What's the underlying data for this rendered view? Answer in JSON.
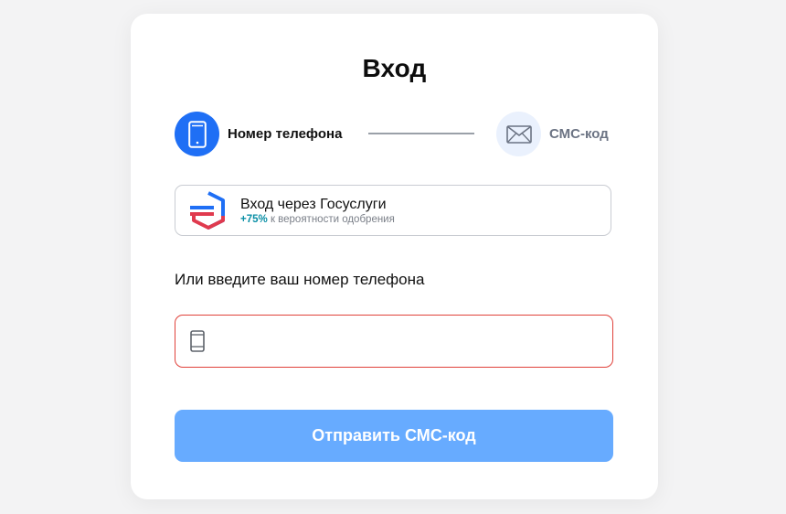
{
  "login": {
    "title": "Вход",
    "steps": [
      {
        "label": "Номер телефона",
        "icon": "phone-icon",
        "state": "active"
      },
      {
        "label": "СМС-код",
        "icon": "envelope-icon",
        "state": "inactive"
      }
    ],
    "gosuslugi": {
      "title": "Вход через Госуслуги",
      "percent": "+75%",
      "subtitle": "к вероятности одобрения",
      "icon": "gosuslugi-logo"
    },
    "phone_label": "Или введите ваш номер телефона",
    "phone_input": {
      "value": "",
      "placeholder": "",
      "icon": "phone-icon"
    },
    "submit_label": "Отправить СМС-код"
  },
  "colors": {
    "accent": "#1f6ff5",
    "submit_bg": "#67abff",
    "error_border": "#e0413a",
    "percent": "#0a8fa6"
  }
}
